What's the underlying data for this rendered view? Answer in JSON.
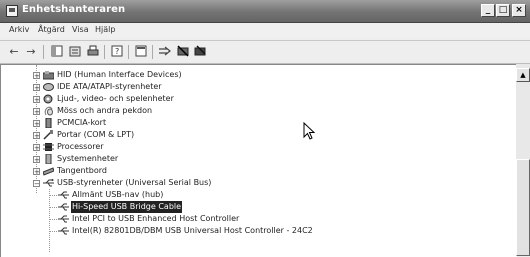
{
  "window": {
    "title": "Enhetshanteraren",
    "buttons": {
      "minimize": "_",
      "maximize": "□",
      "close": "×"
    }
  },
  "menu": [
    "Arkiv",
    "Åtgärd",
    "Visa",
    "Hjälp"
  ],
  "toolbar": {
    "buttons": [
      "back-arrow-icon",
      "forward-arrow-icon",
      "show-hide-tree-icon",
      "properties-icon",
      "print-icon",
      "help-icon",
      "console-view-icon",
      "scan-hardware-icon",
      "disable-device-icon",
      "uninstall-device-icon"
    ]
  },
  "tree": {
    "categories": [
      {
        "label": "HID (Human Interface Devices)",
        "icon": "hid-icon"
      },
      {
        "label": "IDE ATA/ATAPI-styrenheter",
        "icon": "ide-icon"
      },
      {
        "label": "Ljud-, video- och spelenheter",
        "icon": "audio-icon"
      },
      {
        "label": "Möss och andra pekdon",
        "icon": "mouse-icon"
      },
      {
        "label": "PCMCIA-kort",
        "icon": "pcmcia-icon"
      },
      {
        "label": "Portar (COM & LPT)",
        "icon": "port-icon"
      },
      {
        "label": "Processorer",
        "icon": "processor-icon"
      },
      {
        "label": "Systemenheter",
        "icon": "system-icon"
      },
      {
        "label": "Tangentbord",
        "icon": "keyboard-icon"
      },
      {
        "label": "USB-styrenheter (Universal Serial Bus)",
        "icon": "usb-icon"
      }
    ],
    "usb_children": [
      {
        "label": "Allmänt USB-nav (hub)",
        "selected": false
      },
      {
        "label": "Hi-Speed USB Bridge Cable",
        "selected": true
      },
      {
        "label": "Intel PCI to USB Enhanced Host Controller",
        "selected": false
      },
      {
        "label": "Intel(R) 82801DB/DBM USB Universal Host Controller - 24C2",
        "selected": false
      }
    ]
  }
}
